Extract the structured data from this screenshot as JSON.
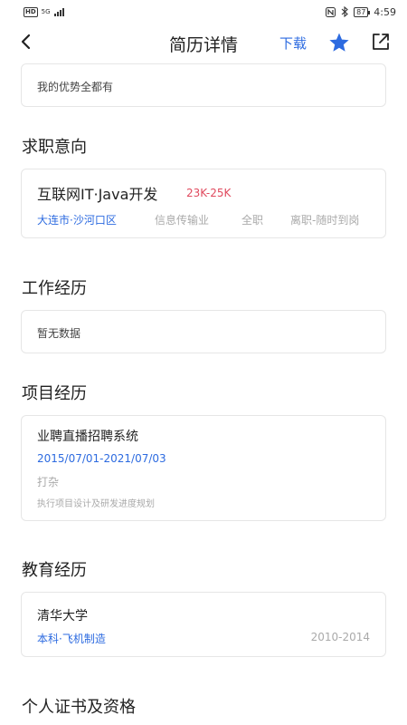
{
  "status_bar": {
    "hd": "HD",
    "signal": "5G",
    "battery": "87",
    "time": "4:59",
    "icons": [
      "nfc-icon",
      "bluetooth-icon"
    ]
  },
  "nav": {
    "title": "简历详情",
    "download_label": "下载",
    "icons": {
      "back": "chevron-left-icon",
      "favorite": "star-icon",
      "share": "share-icon"
    },
    "accent_color": "#2d6be0"
  },
  "advantage": {
    "text": "我的优势全都有"
  },
  "intent": {
    "title": "求职意向",
    "position": "互联网IT·Java开发",
    "salary": "23K-25K",
    "city": "大连市·沙河口区",
    "industry": "信息传输业",
    "job_type": "全职",
    "status": "离职-随时到岗",
    "salary_color": "#e04a5e"
  },
  "work": {
    "title": "工作经历",
    "empty_text": "暂无数据"
  },
  "project": {
    "title": "项目经历",
    "name": "业聘直播招聘系统",
    "date_range": "2015/07/01-2021/07/03",
    "role": "打杂",
    "description": "执行项目设计及研发进度规划"
  },
  "education": {
    "title": "教育经历",
    "school": "清华大学",
    "degree_major": "本科·飞机制造",
    "years": "2010-2014"
  },
  "certificates": {
    "title": "个人证书及资格"
  }
}
